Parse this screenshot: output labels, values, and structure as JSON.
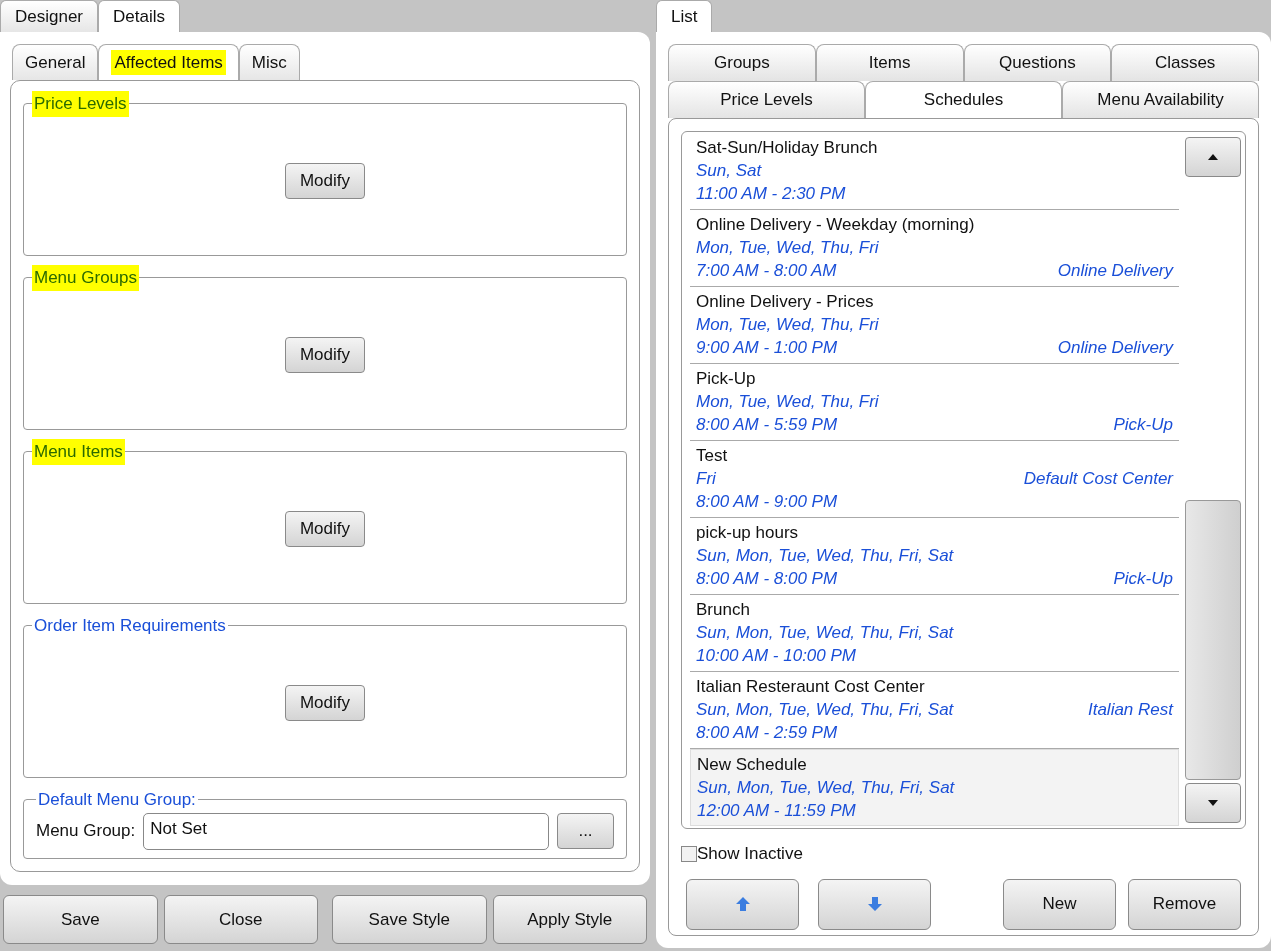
{
  "left_tabs": [
    {
      "label": "Designer",
      "selected": false
    },
    {
      "label": "Details",
      "selected": true
    }
  ],
  "detail_tabs": [
    {
      "label": "General",
      "selected": false,
      "highlighted": false
    },
    {
      "label": "Affected Items",
      "selected": true,
      "highlighted": true
    },
    {
      "label": "Misc",
      "selected": false,
      "highlighted": false
    }
  ],
  "groups": [
    {
      "title": "Price Levels",
      "highlighted": true,
      "button": "Modify"
    },
    {
      "title": "Menu Groups",
      "highlighted": true,
      "button": "Modify"
    },
    {
      "title": "Menu Items",
      "highlighted": true,
      "button": "Modify"
    },
    {
      "title": "Order Item Requirements",
      "highlighted": false,
      "button": "Modify"
    }
  ],
  "default_menu_group": {
    "title": "Default Menu Group:",
    "label": "Menu Group:",
    "value": "Not Set",
    "browse_button": "..."
  },
  "footer_buttons": [
    "Save",
    "Close",
    "Save Style",
    "Apply Style"
  ],
  "right_tabs": [
    {
      "label": "List",
      "selected": true
    }
  ],
  "list_tab_rows": [
    [
      {
        "label": "Groups",
        "selected": false
      },
      {
        "label": "Items",
        "selected": false
      },
      {
        "label": "Questions",
        "selected": false
      },
      {
        "label": "Classes",
        "selected": false
      }
    ],
    [
      {
        "label": "Price Levels",
        "selected": false
      },
      {
        "label": "Schedules",
        "selected": true
      },
      {
        "label": "Menu Availability",
        "selected": false
      }
    ]
  ],
  "schedules": [
    {
      "name": "Sat-Sun/Holiday Brunch",
      "days": "Sun, Sat",
      "time": "11:00 AM - 2:30 PM",
      "selected": false
    },
    {
      "name": "Online Delivery - Weekday (morning)",
      "days": "Mon, Tue, Wed, Thu, Fri",
      "time": "7:00 AM - 8:00 AM",
      "time_note": "Online Delivery",
      "selected": false
    },
    {
      "name": "Online Delivery - Prices",
      "days": "Mon, Tue, Wed, Thu, Fri",
      "time": "9:00 AM - 1:00 PM",
      "time_note": "Online Delivery",
      "selected": false
    },
    {
      "name": "Pick-Up",
      "days": "Mon, Tue, Wed, Thu, Fri",
      "time": "8:00 AM - 5:59 PM",
      "time_note": "Pick-Up",
      "selected": false
    },
    {
      "name": "Test",
      "days": "Fri",
      "days_note": "Default Cost Center",
      "time": "8:00 AM - 9:00 PM",
      "selected": false
    },
    {
      "name": "pick-up hours",
      "days": "Sun, Mon, Tue, Wed, Thu, Fri, Sat",
      "time": "8:00 AM - 8:00 PM",
      "time_note": "Pick-Up",
      "selected": false
    },
    {
      "name": "Brunch",
      "days": "Sun, Mon, Tue, Wed, Thu, Fri, Sat",
      "time": "10:00 AM - 10:00 PM",
      "selected": false
    },
    {
      "name": "Italian Resteraunt Cost Center",
      "days": "Sun, Mon, Tue, Wed, Thu, Fri, Sat",
      "days_note": "Italian Rest",
      "time": "8:00 AM - 2:59 PM",
      "selected": false
    },
    {
      "name": "New Schedule",
      "days": "Sun, Mon, Tue, Wed, Thu, Fri, Sat",
      "time": "12:00 AM - 11:59 PM",
      "selected": true
    }
  ],
  "show_inactive": {
    "label": "Show Inactive",
    "checked": false
  },
  "list_buttons": [
    {
      "kind": "up"
    },
    {
      "kind": "down"
    },
    {
      "kind": "text",
      "label": "New"
    },
    {
      "kind": "text",
      "label": "Remove"
    }
  ]
}
